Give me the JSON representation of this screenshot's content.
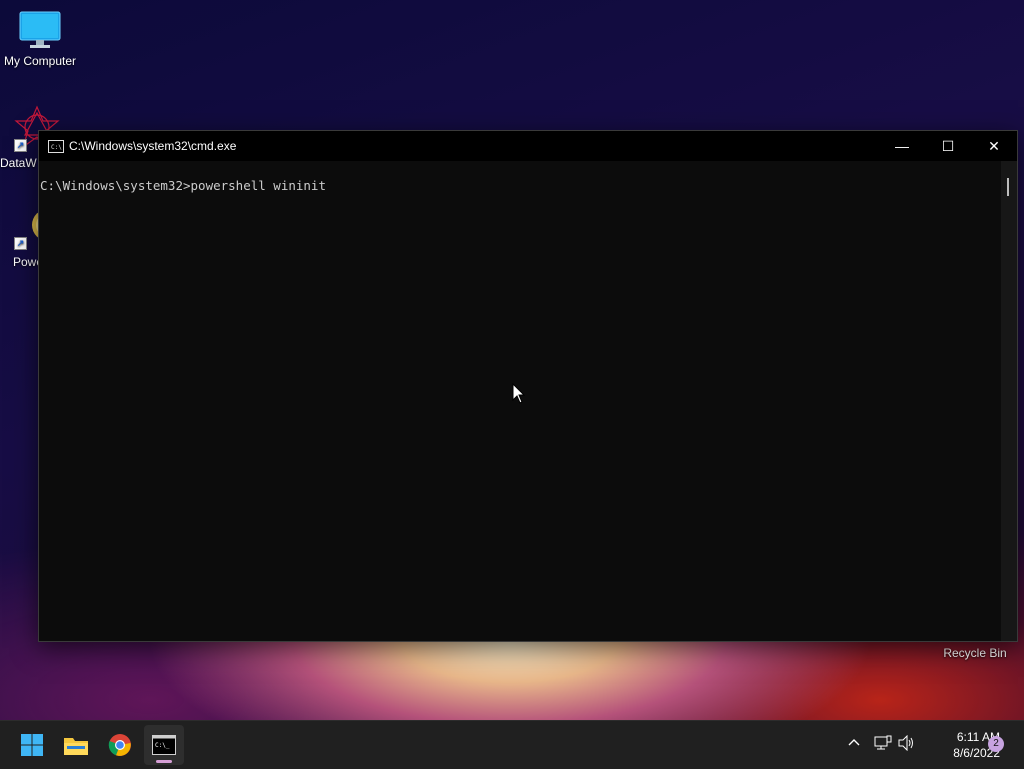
{
  "desktop": {
    "icons": [
      {
        "label": "My Computer"
      },
      {
        "label": "DataW"
      },
      {
        "label": "Powe"
      }
    ],
    "recycle_bin": "Recycle Bin"
  },
  "window": {
    "title": "C:\\Windows\\system32\\cmd.exe",
    "minimize": "—",
    "maximize": "☐",
    "close": "✕",
    "console_line": "C:\\Windows\\system32>powershell wininit"
  },
  "taskbar": {
    "start_icon": "windows-logo",
    "apps": [
      "file-explorer-icon",
      "chrome-icon",
      "cmd-icon"
    ],
    "tray": {
      "chevron": "^",
      "network": "network-icon",
      "volume": "volume-icon"
    },
    "time": "6:11 AM",
    "date": "8/6/2022",
    "notification_count": "2"
  }
}
